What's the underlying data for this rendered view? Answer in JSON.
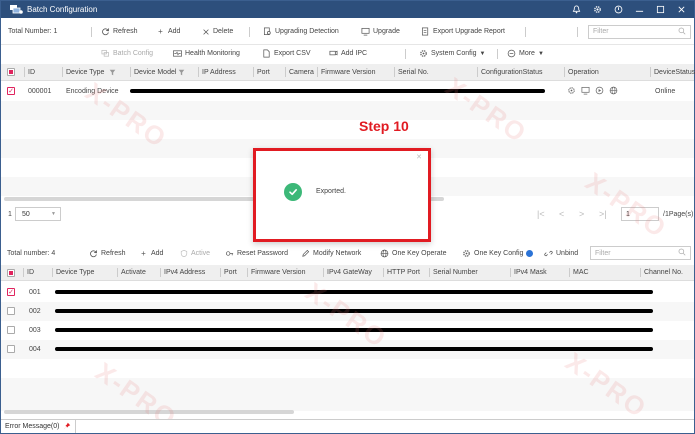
{
  "window": {
    "title": "Batch Configuration",
    "icons": [
      "bell-icon",
      "gear-icon",
      "power-icon",
      "minimize-icon",
      "maximize-icon",
      "close-icon"
    ]
  },
  "toolbar": {
    "total_number": "Total Number: 1",
    "refresh": "Refresh",
    "add": "Add",
    "delete": "Delete",
    "upgrading_detection": "Upgrading Detection",
    "upgrade": "Upgrade",
    "export_upgrade_report": "Export Upgrade Report",
    "filter_placeholder": "Filter",
    "batch_config": "Batch Config",
    "health_monitoring": "Health Monitoring",
    "export_csv": "Export CSV",
    "add_ipc": "Add IPC",
    "system_config": "System Config",
    "more": "More"
  },
  "upper_table": {
    "headers": [
      "ID",
      "Device Type",
      "Device Model",
      "IP Address",
      "Port",
      "Camera",
      "Firmware Version",
      "Serial No.",
      "ConfigurationStatus",
      "Operation",
      "DeviceStatus"
    ],
    "rows": [
      {
        "id": "000001",
        "device_type": "Encoding Device",
        "status": "Online"
      }
    ]
  },
  "pager": {
    "page_size": "50",
    "page": "1",
    "total_pages": "/1Page(s)"
  },
  "annotation": {
    "step": "Step 10"
  },
  "dialog": {
    "message": "Exported."
  },
  "lower_toolbar": {
    "total_number": "Total number: 4",
    "refresh": "Refresh",
    "add": "Add",
    "active": "Active",
    "reset_password": "Reset Password",
    "modify_network": "Modify Network",
    "one_key_operate": "One Key Operate",
    "one_key_config": "One Key Config",
    "unbind": "Unbind",
    "filter_placeholder": "Filter"
  },
  "lower_table": {
    "headers": [
      "ID",
      "Device Type",
      "Activate",
      "IPv4 Address",
      "Port",
      "Firmware Version",
      "IPv4 GateWay",
      "HTTP Port",
      "Serial Number",
      "IPv4 Mask",
      "MAC",
      "Channel No."
    ],
    "rows": [
      {
        "id": "001",
        "checked": true
      },
      {
        "id": "002",
        "checked": false
      },
      {
        "id": "003",
        "checked": false
      },
      {
        "id": "004",
        "checked": false
      }
    ]
  },
  "statusbar": {
    "error_message": "Error Message(0)"
  },
  "colors": {
    "titlebar": "#2d4f7c",
    "accent_red": "#e11b22",
    "success_green": "#3cb878",
    "checkbox_accent": "#e0245e"
  }
}
